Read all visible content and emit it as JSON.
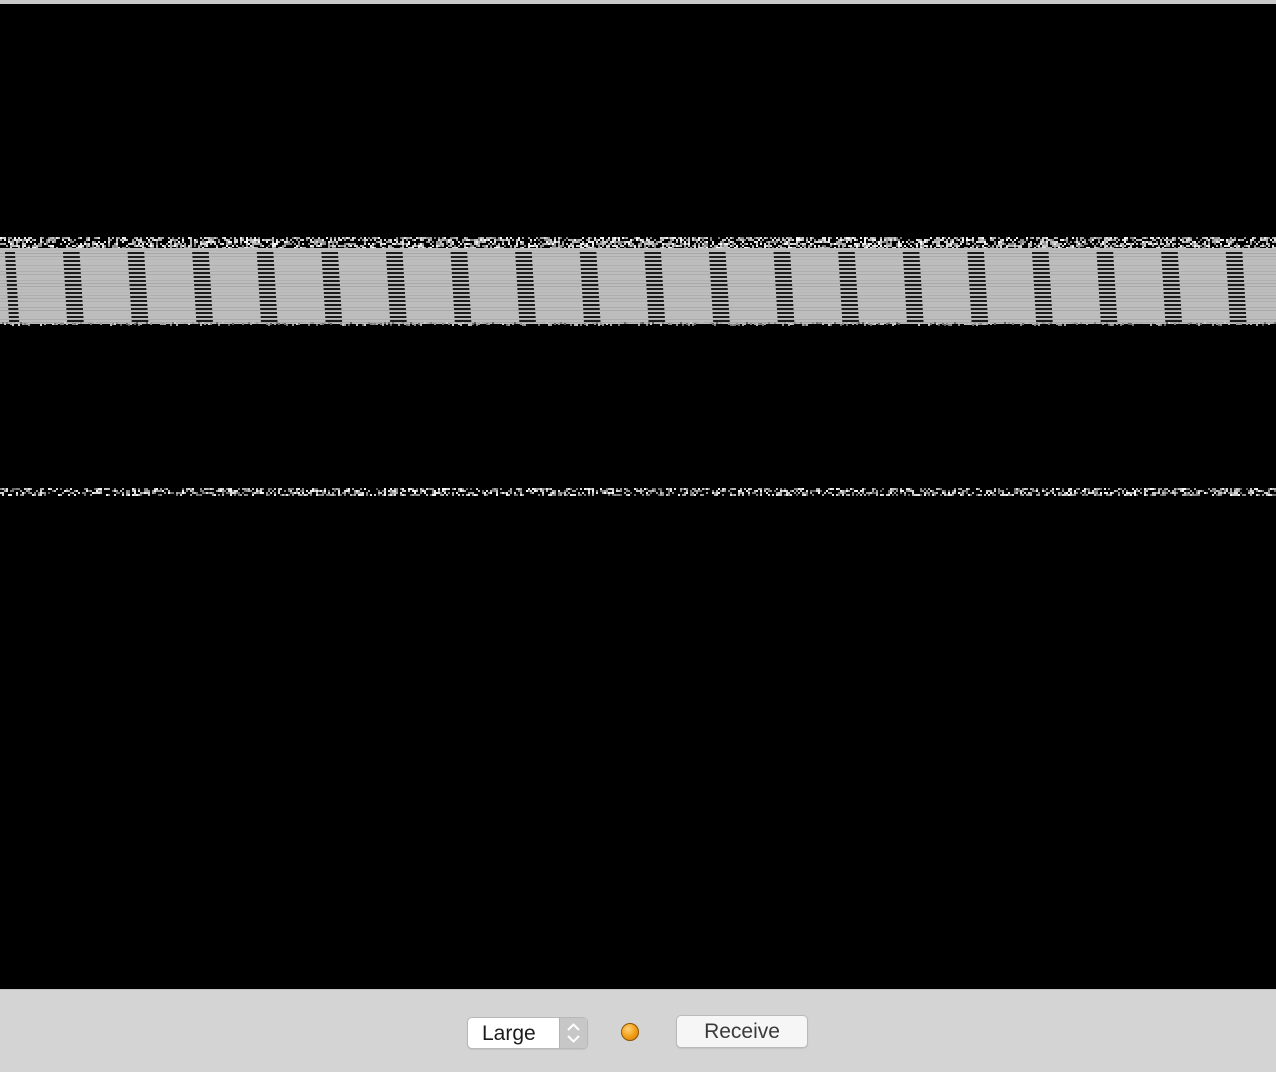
{
  "toolbar": {
    "size_select": {
      "selected": "Large"
    },
    "status_indicator": {
      "color": "#f2a21b"
    },
    "receive_label": "Receive"
  },
  "viewer": {
    "background": "#000000",
    "signal_color": "#c8c8c8"
  }
}
